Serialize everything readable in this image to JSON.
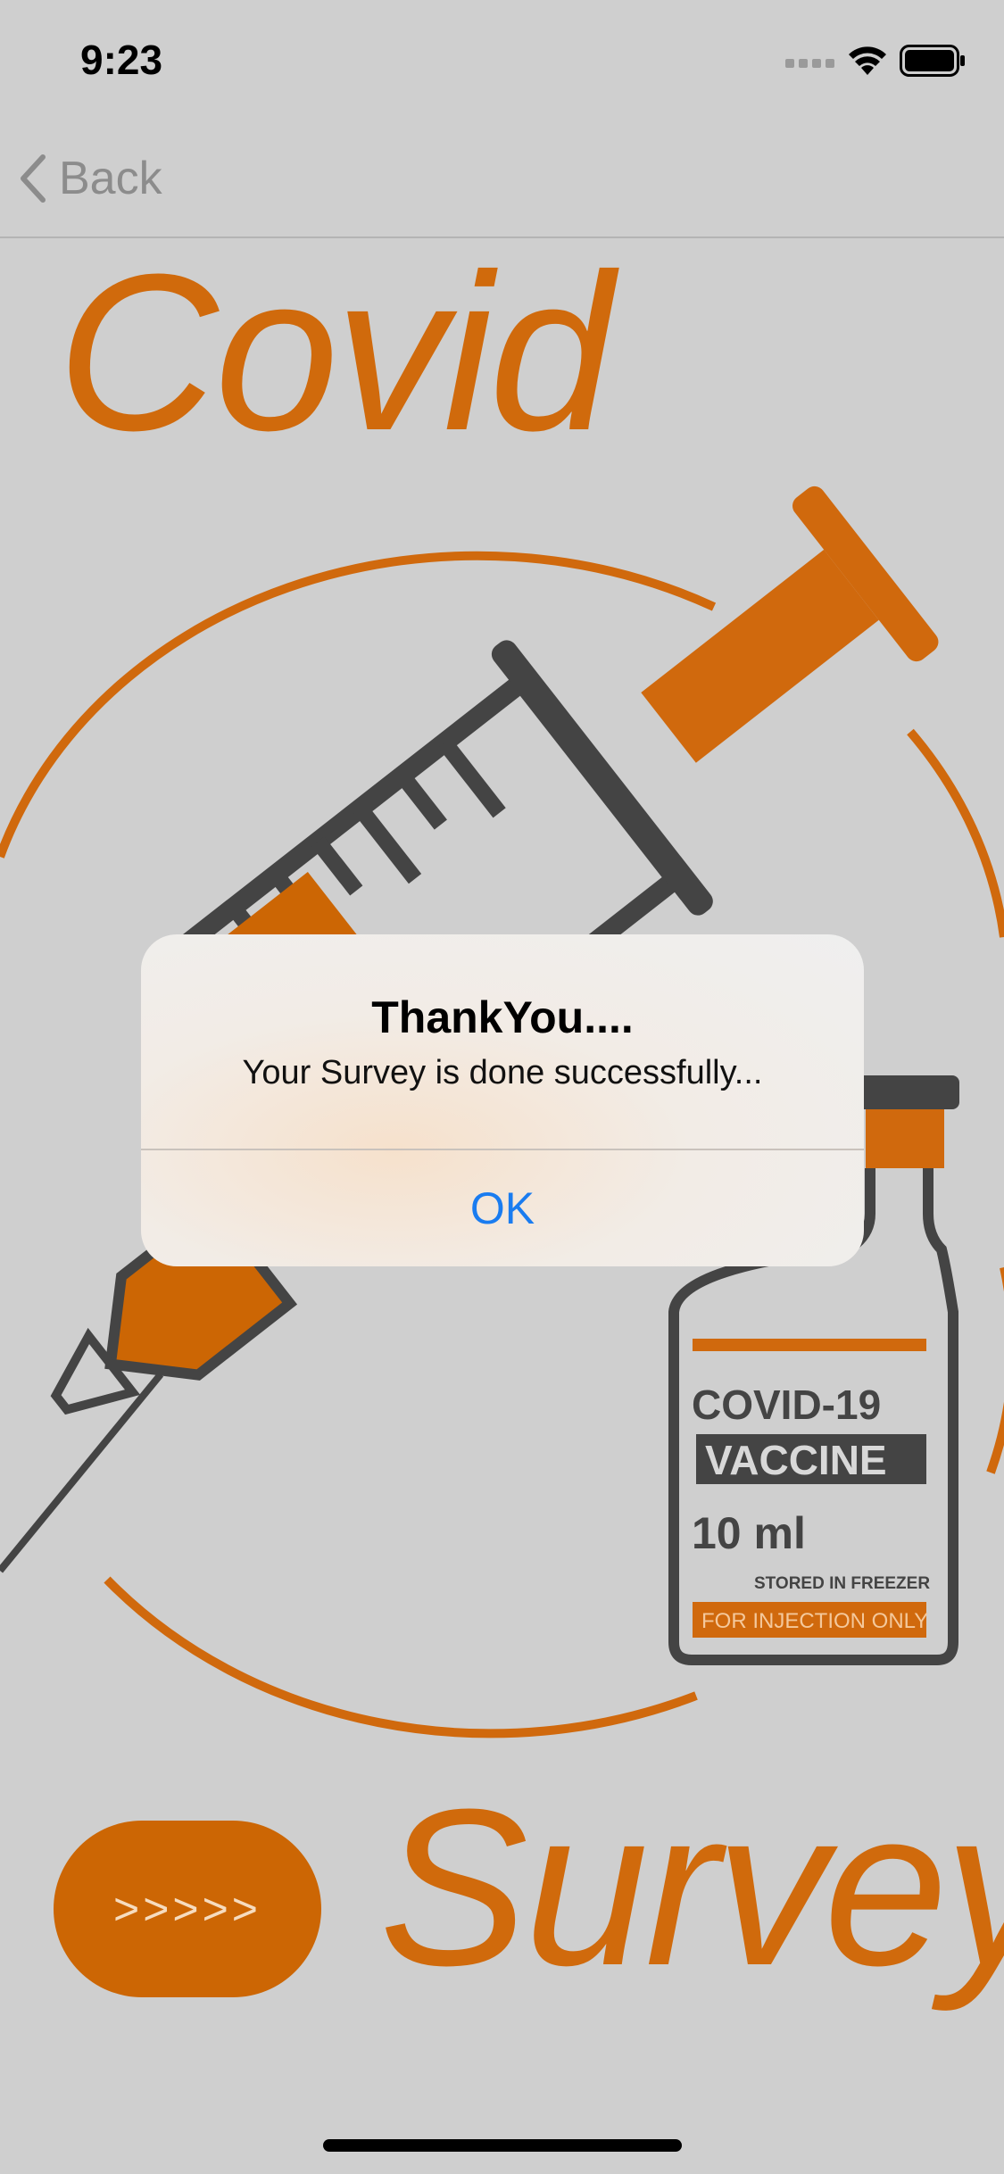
{
  "status_bar": {
    "time": "9:23"
  },
  "nav": {
    "back_label": "Back"
  },
  "content": {
    "title_top": "Covid",
    "title_bottom": "Survey",
    "next_button_label": ">>>>>"
  },
  "illustration": {
    "vial_label_line1": "COVID-19",
    "vial_label_line2": "VACCINE",
    "vial_volume": "10 ml",
    "vial_storage": "STORED IN FREEZER",
    "vial_use": "FOR INJECTION ONLY"
  },
  "alert": {
    "title": "ThankYou....",
    "message": "Your Survey is done successfully...",
    "ok_label": "OK"
  },
  "colors": {
    "accent_orange": "#d06a0c",
    "ios_blue": "#1a7cf0",
    "background": "#cfcfcf"
  }
}
